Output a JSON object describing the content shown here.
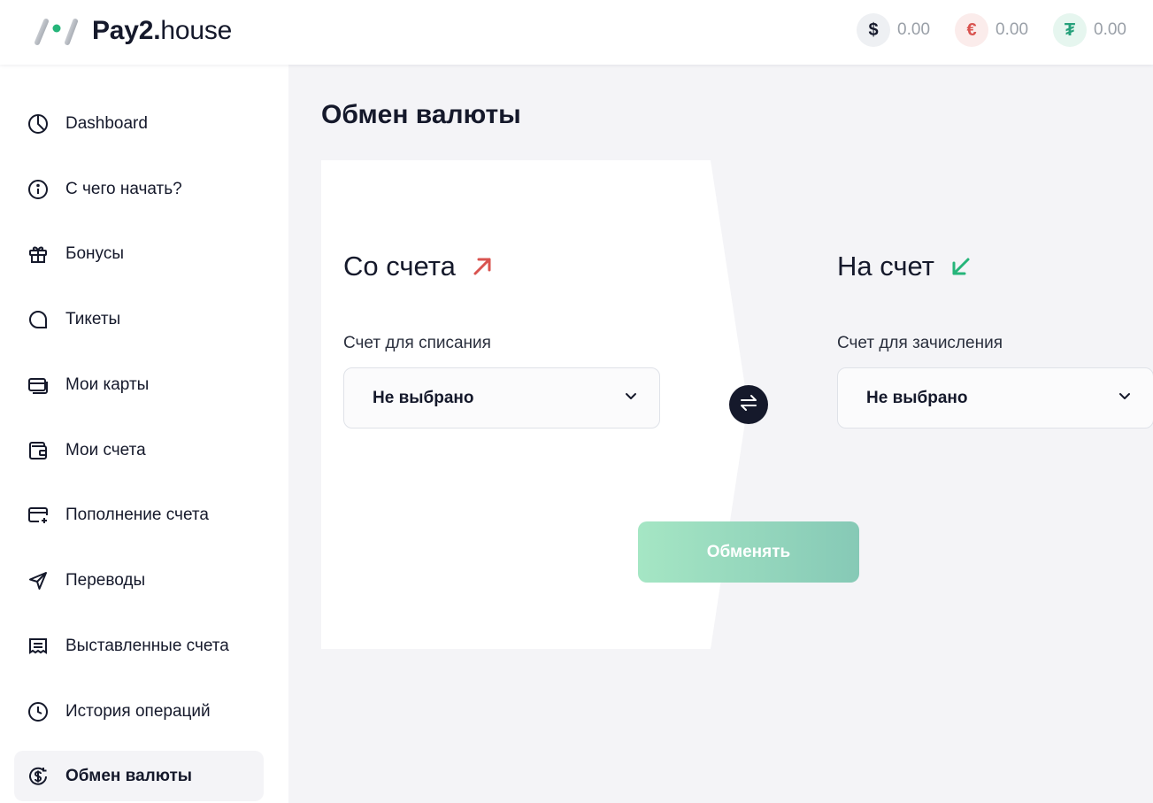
{
  "header": {
    "logo_bold": "Pay2.",
    "logo_light": "house",
    "balances": [
      {
        "icon": "dollar-icon",
        "symbol": "$",
        "amount": "0.00"
      },
      {
        "icon": "euro-icon",
        "symbol": "€",
        "amount": "0.00"
      },
      {
        "icon": "tether-icon",
        "symbol": "₮",
        "amount": "0.00"
      }
    ]
  },
  "sidebar": {
    "items": [
      {
        "label": "Dashboard",
        "icon": "pie-chart-icon"
      },
      {
        "label": "С чего начать?",
        "icon": "info-icon"
      },
      {
        "label": "Бонусы",
        "icon": "gift-icon"
      },
      {
        "label": "Тикеты",
        "icon": "chat-icon"
      },
      {
        "label": "Мои карты",
        "icon": "cards-icon"
      },
      {
        "label": "Мои счета",
        "icon": "wallet-icon"
      },
      {
        "label": "Пополнение счета",
        "icon": "card-add-icon"
      },
      {
        "label": "Переводы",
        "icon": "send-icon"
      },
      {
        "label": "Выставленные счета",
        "icon": "receipt-icon"
      },
      {
        "label": "История операций",
        "icon": "clock-icon"
      },
      {
        "label": "Обмен валюты",
        "icon": "exchange-dollar-icon",
        "active": true
      }
    ]
  },
  "main": {
    "title": "Обмен валюты",
    "from": {
      "title": "Со счета",
      "field_label": "Счет для списания",
      "value": "Не выбрано"
    },
    "to": {
      "title": "На счет",
      "field_label": "Счет для зачисления",
      "value": "Не выбрано"
    },
    "exchange_button": "Обменять"
  },
  "colors": {
    "accent_green": "#26b57a",
    "accent_red": "#d9534f",
    "dark": "#15192b",
    "panel_bg": "#f4f4f7"
  }
}
